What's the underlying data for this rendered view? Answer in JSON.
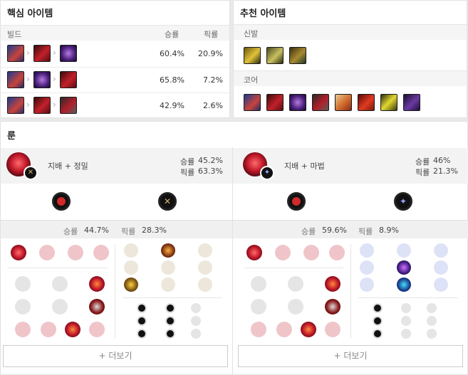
{
  "core_items": {
    "title": "핵심 아이템",
    "header": {
      "build": "빌드",
      "winrate": "승률",
      "pickrate": "픽률"
    },
    "rows": [
      {
        "winrate": "60.4%",
        "pickrate": "20.9%"
      },
      {
        "winrate": "65.8%",
        "pickrate": "7.2%"
      },
      {
        "winrate": "42.9%",
        "pickrate": "2.6%"
      }
    ]
  },
  "recommended_items": {
    "title": "추천 아이템",
    "boots_label": "신발",
    "core_label": "코어"
  },
  "runes": {
    "title": "룬",
    "pages": [
      {
        "name": "지배 + 정밀",
        "winrate_label": "승률",
        "winrate": "45.2%",
        "pickrate_label": "픽률",
        "pickrate": "63.3%",
        "detail_winrate_label": "승률",
        "detail_winrate": "44.7%",
        "detail_pickrate_label": "픽률",
        "detail_pickrate": "28.3%",
        "more_label": "+ 더보기"
      },
      {
        "name": "지배 + 마법",
        "winrate_label": "승률",
        "winrate": "46%",
        "pickrate_label": "픽률",
        "pickrate": "21.3%",
        "detail_winrate_label": "승률",
        "detail_winrate": "59.6%",
        "detail_pickrate_label": "픽률",
        "detail_pickrate": "8.9%",
        "more_label": "+ 더보기"
      }
    ]
  },
  "colors": {
    "accent": "#b4132b",
    "panel_bg": "#ffffff",
    "header_bg": "#f5f5f5",
    "page_bg": "#e9e9e9"
  }
}
